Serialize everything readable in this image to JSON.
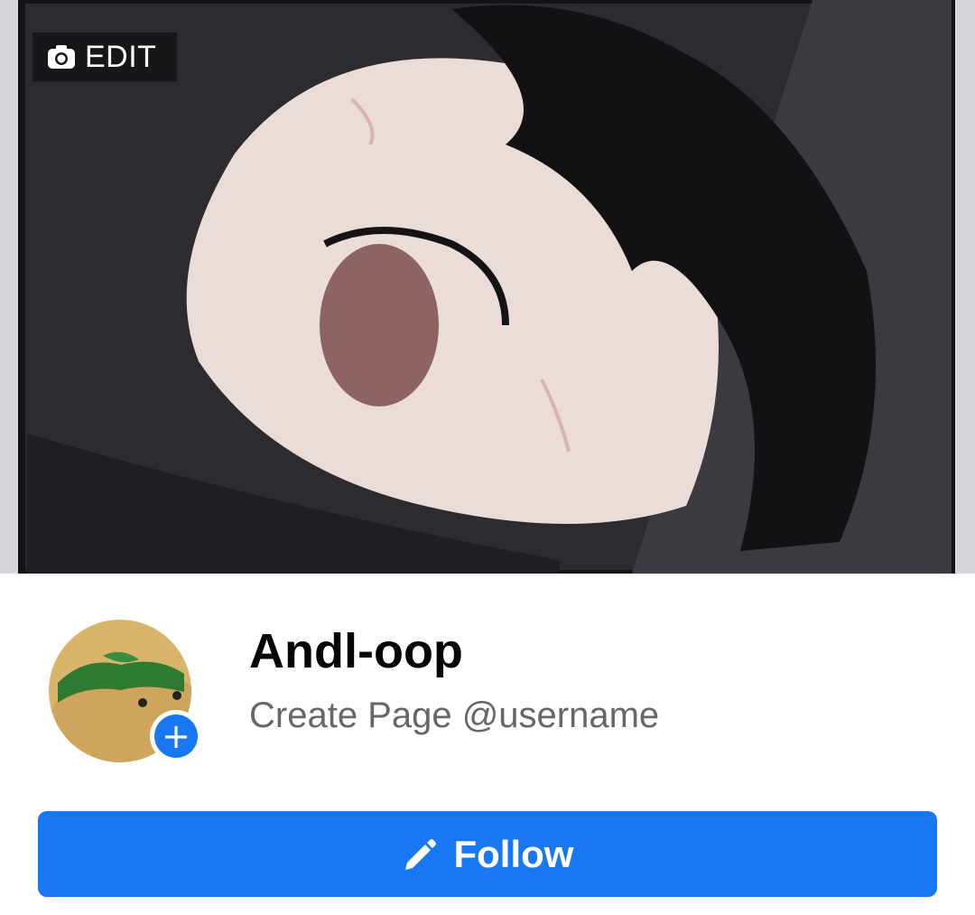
{
  "cover": {
    "edit_label": "EDIT",
    "edit_icon": "camera-icon"
  },
  "profile": {
    "name": "Andl-oop",
    "username_prompt": "Create Page @username",
    "add_photo_symbol": "+"
  },
  "actions": {
    "follow_label": "Follow",
    "follow_icon": "pencil-icon"
  },
  "colors": {
    "accent": "#1877f2",
    "secondary_text": "#65676b",
    "primary_text": "#050505"
  }
}
